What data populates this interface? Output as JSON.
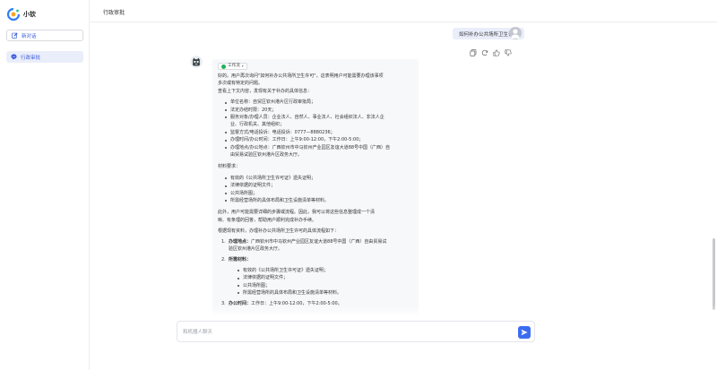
{
  "app": {
    "name": "小钦"
  },
  "sidebar": {
    "new_chat_label": "新对话",
    "items": [
      {
        "label": "行政审批",
        "active": true
      }
    ]
  },
  "header": {
    "title": "行政审批"
  },
  "conversation": {
    "user_message": "如何补办公共场所卫生许可",
    "workflow_tag": "工作流",
    "answer": {
      "intro_lines": [
        "好的。用户再次询问\"如何补办公共场所卫生许可\"，这表明用户可能需要办理该事项",
        "多次或有特定的问题。",
        "查看上下文内容，发现有关于补办的具体信息："
      ],
      "info_bullets": [
        "单位名称：自贸区钦州港片区行政审批局；",
        "法定办结时限：20天；",
        "服务对象/办理人员：企业法人、自然人、事业法人、社会组织法人、非法人企",
        "业、行政机关、其他组织；",
        "监督方式/电话投诉：电话投诉：0777—8880236；",
        "办理时间/办公时间：工作日：上午9:00-12:00，下午2:00-5:00；",
        "办理地点/办公地点：广西钦州市中马钦州产业园区友谊大道88号中国（广西）自",
        "由贸易试验区钦州港片区政务大厅。"
      ],
      "materials_title": "材料要求：",
      "materials": [
        "有效的《公共场所卫生许可证》遗失证明；",
        "法律依据的证明文件；",
        "公共场所图；",
        "所需经营场所的具体布局和卫生设施清单等材料。"
      ],
      "mid_lines": [
        "此外，用户可能需要详细的步骤或流程。因此，我可以将这些信息整理成一个清",
        "晰、有条理的回答，帮助用户顺利完成补办手续。"
      ],
      "basis_line": "根据现有资料，办理补办公共场所卫生许可的具体流程如下：",
      "steps": [
        {
          "num": "1.",
          "title": "办理地点：",
          "lines": [
            "广西钦州市中马钦州产业园区友谊大道88号中国（广西）自由贸易试",
            "验区钦州港片区政务大厅。"
          ]
        },
        {
          "num": "2.",
          "title": "所需材料：",
          "lines": []
        },
        {
          "num": "3.",
          "title": "办公时间：",
          "lines": [
            "工作日：上午9:00-12:00，下午2:00-5:00。"
          ]
        }
      ],
      "step2_items": [
        "有效的《公共场所卫生许可证》遗失证明；",
        "法律依据的证明文件；",
        "公共场所图；",
        "所需经营场所的具体布局和卫生设施清单等材料。"
      ]
    }
  },
  "input": {
    "placeholder": "和机器人聊天",
    "value": ""
  },
  "colors": {
    "accent": "#3b6cf0",
    "user_bubble": "#eaeefa",
    "answer_bg": "#f7f8fa"
  },
  "icons": [
    "app-logo-icon",
    "edit-icon",
    "chat-icon",
    "copy-icon",
    "refresh-icon",
    "thumb-up-icon",
    "thumb-down-icon",
    "bot-avatar-icon",
    "user-avatar-icon",
    "send-icon",
    "check-circle-icon"
  ]
}
